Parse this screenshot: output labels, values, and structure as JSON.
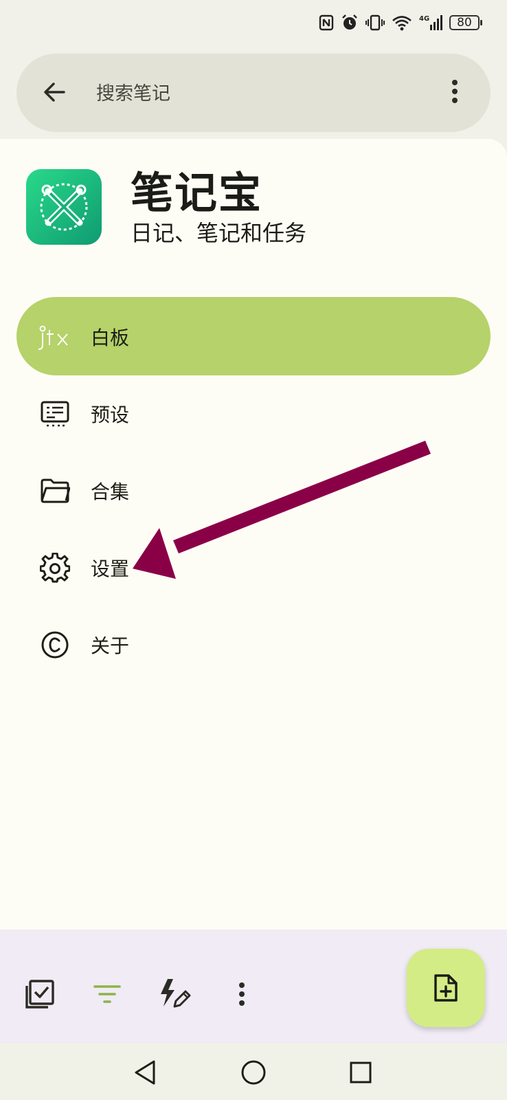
{
  "status_bar": {
    "battery_level": "80",
    "icons": [
      "nfc-icon",
      "alarm-icon",
      "vibrate-icon",
      "wifi-icon",
      "signal-4g-icon",
      "battery-icon"
    ]
  },
  "search": {
    "placeholder": "搜索笔记",
    "back_icon": "arrow-back-icon",
    "more_icon": "more-vert-icon"
  },
  "drawer": {
    "app_title": "笔记宝",
    "app_subtitle": "日记、笔记和任务",
    "items": [
      {
        "label": "白板",
        "icon": "jtx-logo-icon",
        "active": true
      },
      {
        "label": "预设",
        "icon": "presets-icon",
        "active": false
      },
      {
        "label": "合集",
        "icon": "folder-icon",
        "active": false
      },
      {
        "label": "设置",
        "icon": "gear-icon",
        "active": false
      },
      {
        "label": "关于",
        "icon": "copyright-icon",
        "active": false
      }
    ]
  },
  "annotation": {
    "arrow_color": "#8a0047",
    "points_to": "设置"
  },
  "bottom_bar": {
    "buttons": [
      "checklist-icon",
      "filter-icon",
      "quick-edit-icon",
      "more-vert-icon"
    ],
    "filter_active_color": "#8db34a",
    "fab_icon": "add-note-icon"
  },
  "system_nav": [
    "back-triangle-icon",
    "home-circle-icon",
    "recents-square-icon"
  ],
  "colors": {
    "accent": "#b6d26a",
    "fab": "#d3ec86",
    "search_bg": "#e2e3d6",
    "drawer_bg": "#fefdf5"
  }
}
